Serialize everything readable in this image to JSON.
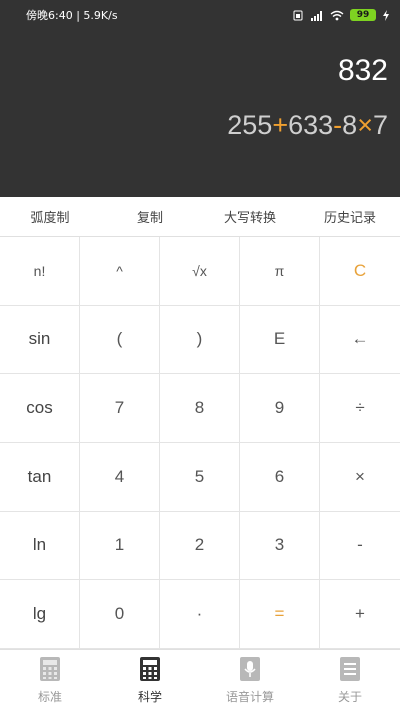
{
  "status_bar": {
    "left_text": "傍晚6:40 | 5.9K/s",
    "battery_level": "99",
    "icons": [
      "sim-icon",
      "signal-icon",
      "wifi-icon",
      "battery-icon",
      "charging-icon"
    ]
  },
  "display": {
    "result": "832",
    "expression_parts": [
      "255",
      "+",
      "633",
      "-",
      "8",
      "×",
      "7"
    ]
  },
  "function_row": [
    "弧度制",
    "复制",
    "大写转换",
    "历史记录"
  ],
  "keys": [
    {
      "label": "n!",
      "name": "key-factorial"
    },
    {
      "label": "^",
      "name": "key-power"
    },
    {
      "label": "√x",
      "name": "key-sqrt"
    },
    {
      "label": "π",
      "name": "key-pi"
    },
    {
      "label": "C",
      "name": "key-clear"
    },
    {
      "label": "sin",
      "name": "key-sin"
    },
    {
      "label": "(",
      "name": "key-left-paren"
    },
    {
      "label": ")",
      "name": "key-right-paren"
    },
    {
      "label": "E",
      "name": "key-e"
    },
    {
      "label": "←",
      "name": "key-backspace"
    },
    {
      "label": "cos",
      "name": "key-cos"
    },
    {
      "label": "7",
      "name": "key-7"
    },
    {
      "label": "8",
      "name": "key-8"
    },
    {
      "label": "9",
      "name": "key-9"
    },
    {
      "label": "÷",
      "name": "key-divide"
    },
    {
      "label": "tan",
      "name": "key-tan"
    },
    {
      "label": "4",
      "name": "key-4"
    },
    {
      "label": "5",
      "name": "key-5"
    },
    {
      "label": "6",
      "name": "key-6"
    },
    {
      "label": "×",
      "name": "key-multiply"
    },
    {
      "label": "ln",
      "name": "key-ln"
    },
    {
      "label": "1",
      "name": "key-1"
    },
    {
      "label": "2",
      "name": "key-2"
    },
    {
      "label": "3",
      "name": "key-3"
    },
    {
      "label": "-",
      "name": "key-subtract"
    },
    {
      "label": "lg",
      "name": "key-lg"
    },
    {
      "label": "0",
      "name": "key-0"
    },
    {
      "label": "·",
      "name": "key-decimal"
    },
    {
      "label": "=",
      "name": "key-equals"
    },
    {
      "label": "+",
      "name": "key-add"
    }
  ],
  "bottom_nav": [
    {
      "label": "标准",
      "icon": "standard-calculator-icon",
      "active": false
    },
    {
      "label": "科学",
      "icon": "scientific-calculator-icon",
      "active": true
    },
    {
      "label": "语音计算",
      "icon": "voice-calculator-icon",
      "active": false
    },
    {
      "label": "关于",
      "icon": "about-icon",
      "active": false
    }
  ],
  "colors": {
    "display_bg": "#333333",
    "accent": "#e8a23a",
    "battery": "#7ed321"
  }
}
